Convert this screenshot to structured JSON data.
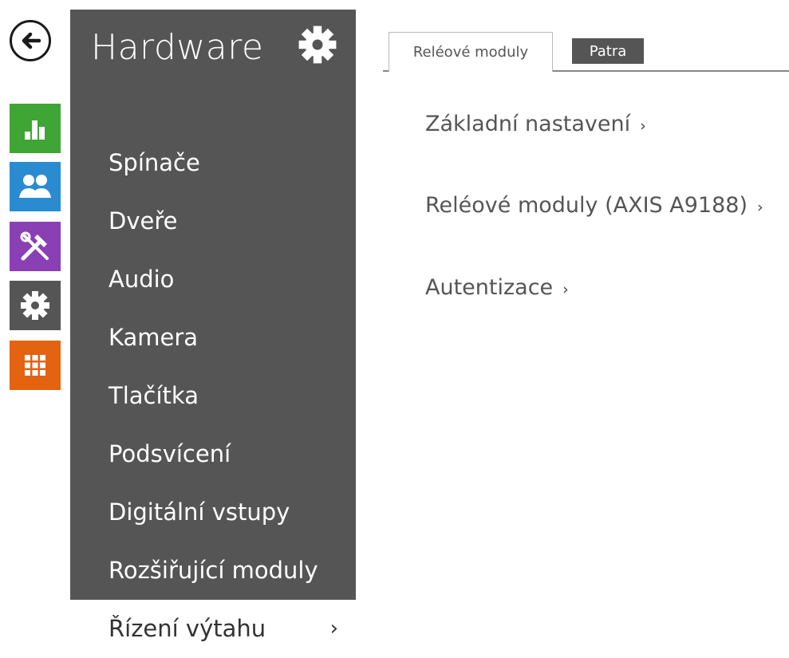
{
  "rail": {
    "back": {
      "icon": "back-arrow-icon",
      "color": "#1a1a1a"
    },
    "items": [
      {
        "icon": "bar-chart-icon",
        "color": "#3fa535"
      },
      {
        "icon": "users-icon",
        "color": "#2a8bd0"
      },
      {
        "icon": "tools-icon",
        "color": "#8a3fb5"
      },
      {
        "icon": "gear-icon",
        "color": "#555555"
      },
      {
        "icon": "grid-icon",
        "color": "#e36310"
      }
    ]
  },
  "sidebar": {
    "title": "Hardware",
    "title_icon": "gear-icon",
    "background": "#555555",
    "items": [
      {
        "label": "Spínače"
      },
      {
        "label": "Dveře"
      },
      {
        "label": "Audio"
      },
      {
        "label": "Kamera"
      },
      {
        "label": "Tlačítka"
      },
      {
        "label": "Podsvícení"
      },
      {
        "label": "Digitální vstupy"
      },
      {
        "label": "Rozšiřující moduly"
      },
      {
        "label": "Řízení výtahu",
        "active": true,
        "chevron": "›"
      }
    ]
  },
  "tabs": [
    {
      "label": "Reléové moduly",
      "active": true
    },
    {
      "label": "Patra",
      "active": false
    }
  ],
  "sections": [
    {
      "label": "Základní nastavení",
      "chevron": "›"
    },
    {
      "label": "Reléové moduly (AXIS A9188)",
      "chevron": "›"
    },
    {
      "label": "Autentizace",
      "chevron": "›"
    }
  ]
}
